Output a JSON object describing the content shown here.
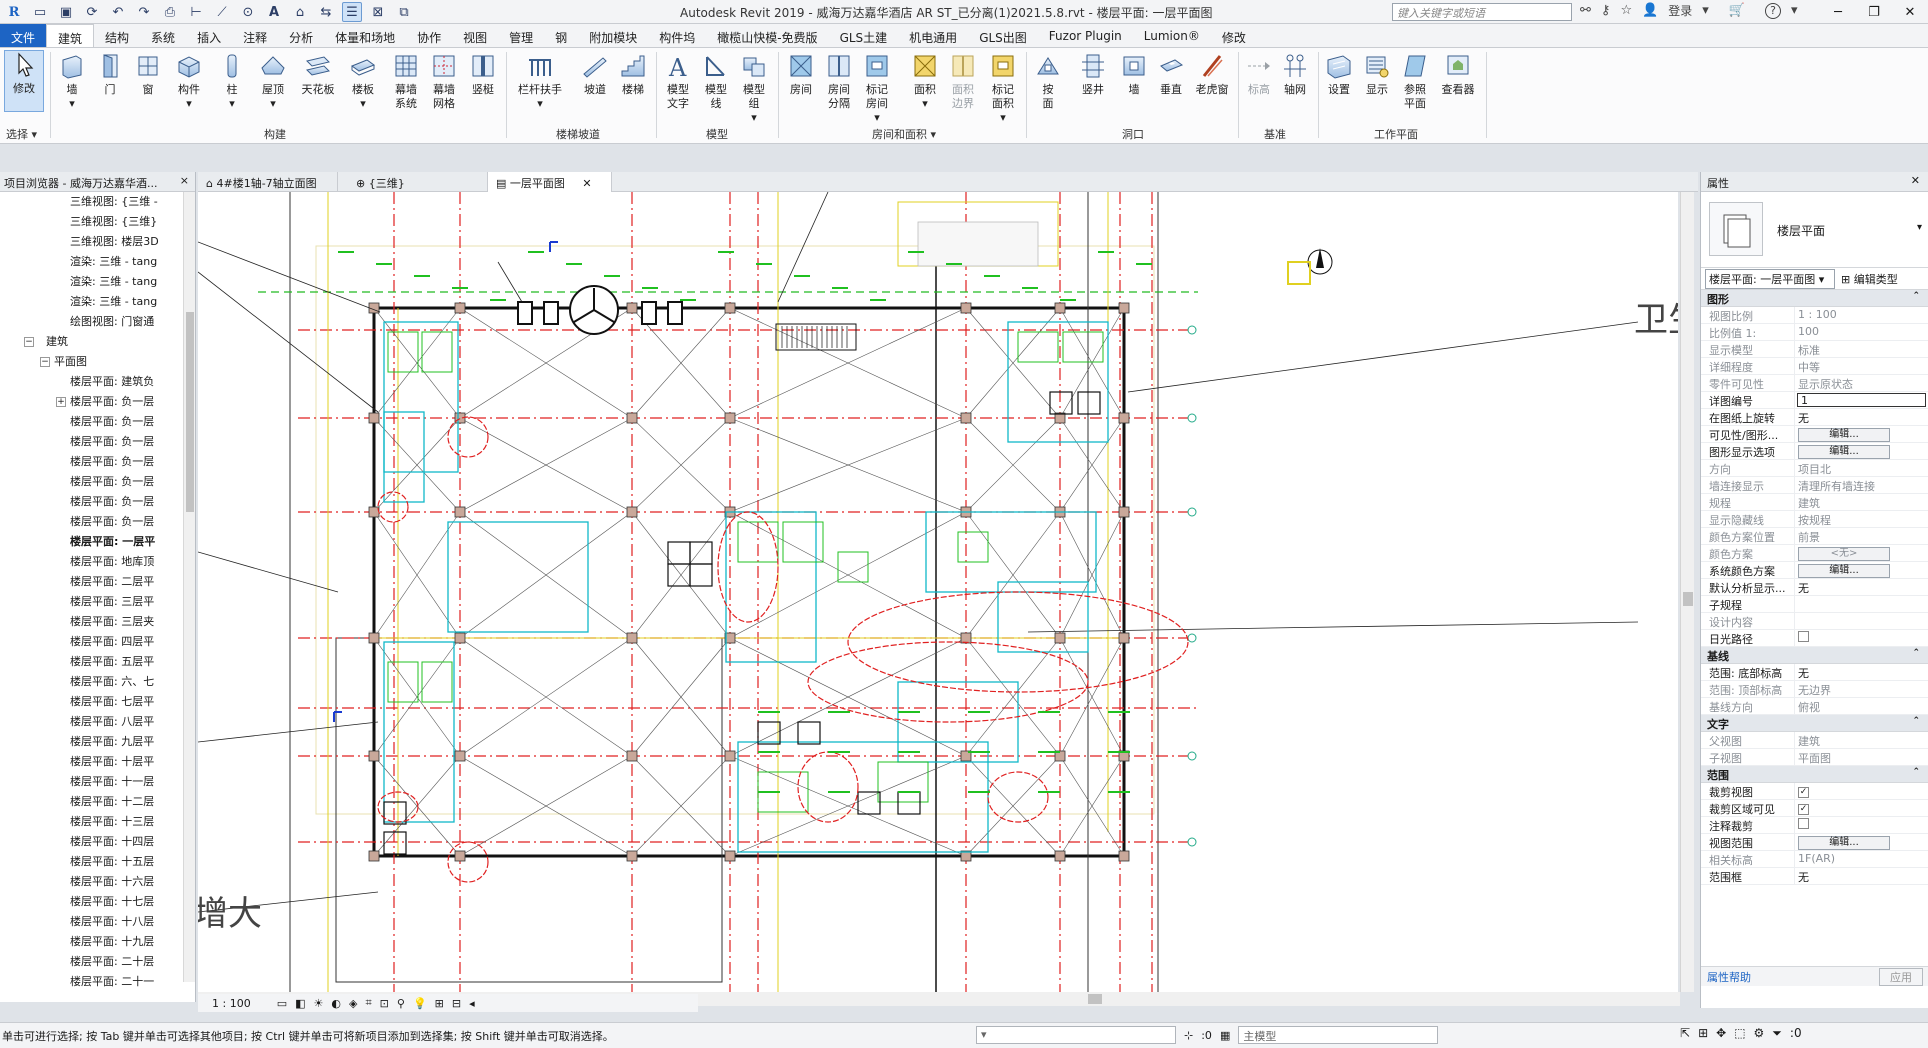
{
  "titlebar": {
    "title": "Autodesk Revit 2019 - 威海万达嘉华酒店 AR ST_已分离(1)2021.5.8.rvt - 楼层平面: 一层平面图",
    "search_placeholder": "键入关键字或短语",
    "login": "登录",
    "help": "?"
  },
  "menu": {
    "tabs": [
      "文件",
      "建筑",
      "结构",
      "系统",
      "插入",
      "注释",
      "分析",
      "体量和场地",
      "协作",
      "视图",
      "管理",
      "钢",
      "附加模块",
      "构件坞",
      "橄榄山快模-免费版",
      "GLS土建",
      "机电通用",
      "GLS出图",
      "Fuzor Plugin",
      "Lumion®",
      "修改"
    ]
  },
  "ribbon": {
    "modify": "修改",
    "select": "选择",
    "buttons": {
      "wall": "墙",
      "door": "门",
      "window": "窗",
      "component": "构件",
      "column": "柱",
      "roof": "屋顶",
      "ceiling": "天花板",
      "floor": "楼板",
      "curtain_system_1": "幕墙",
      "curtain_system_2": "系统",
      "curtain_grid_1": "幕墙",
      "curtain_grid_2": "网格",
      "mullion": "竖梃",
      "railing": "栏杆扶手",
      "ramp": "坡道",
      "stair": "楼梯",
      "model_text_1": "模型",
      "model_text_2": "文字",
      "model_line_1": "模型",
      "model_line_2": "线",
      "model_group_1": "模型",
      "model_group_2": "组",
      "room": "房间",
      "room_sep_1": "房间",
      "room_sep_2": "分隔",
      "tag_room_1": "标记",
      "tag_room_2": "房间",
      "area": "面积",
      "area_boundary_1": "面积",
      "area_boundary_2": "边界",
      "tag_area_1": "标记",
      "tag_area_2": "面积",
      "by_face_1": "按",
      "by_face_2": "面",
      "shaft": "竖井",
      "wall_opening": "墙",
      "vertical": "垂直",
      "dormer": "老虎窗",
      "level": "标高",
      "grid": "轴网",
      "set": "设置",
      "show": "显示",
      "ref_plane_1": "参照",
      "ref_plane_2": "平面",
      "viewer": "查看器"
    },
    "groups": {
      "build": "构建",
      "circulation": "楼梯坡道",
      "model": "模型",
      "room_area": "房间和面积",
      "opening": "洞口",
      "datum": "基准",
      "work_plane": "工作平面"
    }
  },
  "browser": {
    "header": "项目浏览器 - 威海万达嘉华酒...",
    "close": "×",
    "items": [
      {
        "label": "三维视图: {三维 -",
        "indent": 70
      },
      {
        "label": "三维视图: {三维}",
        "indent": 70
      },
      {
        "label": "三维视图: 楼层3D",
        "indent": 70
      },
      {
        "label": "渲染: 三维 - tang",
        "indent": 70
      },
      {
        "label": "渲染: 三维 - tang",
        "indent": 70
      },
      {
        "label": "渲染: 三维 - tang",
        "indent": 70
      },
      {
        "label": "绘图视图: 门窗通",
        "indent": 70
      },
      {
        "label": "建筑",
        "indent": 46,
        "exp": "−",
        "expIndent": 24
      },
      {
        "label": "平面图",
        "indent": 54,
        "exp": "−",
        "expIndent": 40
      },
      {
        "label": "楼层平面: 建筑负",
        "indent": 70
      },
      {
        "label": "楼层平面: 负一层",
        "indent": 70,
        "exp": "+",
        "expIndent": 56
      },
      {
        "label": "楼层平面: 负一层",
        "indent": 70
      },
      {
        "label": "楼层平面: 负一层",
        "indent": 70
      },
      {
        "label": "楼层平面: 负一层",
        "indent": 70
      },
      {
        "label": "楼层平面: 负一层",
        "indent": 70
      },
      {
        "label": "楼层平面: 负一层",
        "indent": 70
      },
      {
        "label": "楼层平面: 负一层",
        "indent": 70
      },
      {
        "label": "楼层平面: 一层平",
        "indent": 70,
        "sel": true
      },
      {
        "label": "楼层平面: 地库顶",
        "indent": 70
      },
      {
        "label": "楼层平面: 二层平",
        "indent": 70
      },
      {
        "label": "楼层平面: 三层平",
        "indent": 70
      },
      {
        "label": "楼层平面: 三层夹",
        "indent": 70
      },
      {
        "label": "楼层平面: 四层平",
        "indent": 70
      },
      {
        "label": "楼层平面: 五层平",
        "indent": 70
      },
      {
        "label": "楼层平面: 六、七",
        "indent": 70
      },
      {
        "label": "楼层平面: 七层平",
        "indent": 70
      },
      {
        "label": "楼层平面: 八层平",
        "indent": 70
      },
      {
        "label": "楼层平面: 九层平",
        "indent": 70
      },
      {
        "label": "楼层平面: 十层平",
        "indent": 70
      },
      {
        "label": "楼层平面: 十一层",
        "indent": 70
      },
      {
        "label": "楼层平面: 十二层",
        "indent": 70
      },
      {
        "label": "楼层平面: 十三层",
        "indent": 70
      },
      {
        "label": "楼层平面: 十四层",
        "indent": 70
      },
      {
        "label": "楼层平面: 十五层",
        "indent": 70
      },
      {
        "label": "楼层平面: 十六层",
        "indent": 70
      },
      {
        "label": "楼层平面: 十七层",
        "indent": 70
      },
      {
        "label": "楼层平面: 十八层",
        "indent": 70
      },
      {
        "label": "楼层平面: 十九层",
        "indent": 70
      },
      {
        "label": "楼层平面: 二十层",
        "indent": 70
      },
      {
        "label": "楼层平面: 二十一",
        "indent": 70
      }
    ]
  },
  "viewtabs": [
    {
      "label": "4#楼1轴-7轴立面图",
      "icon": "elevation"
    },
    {
      "label": "{三维}",
      "icon": "3d"
    },
    {
      "label": "一层平面图",
      "icon": "plan",
      "active": true
    }
  ],
  "canvas": {
    "text_weisheng": "卫生",
    "text_zengda": "增大"
  },
  "viewbar": {
    "scale": "1 : 100"
  },
  "properties": {
    "header": "属性",
    "type_name": "楼层平面",
    "selector": "楼层平面: 一层平面图",
    "edit_type": "编辑类型",
    "groups": [
      {
        "name": "图形",
        "rows": [
          {
            "k": "视图比例",
            "v": "1 : 100",
            "ro": true
          },
          {
            "k": "比例值 1:",
            "v": "100",
            "ro": true
          },
          {
            "k": "显示模型",
            "v": "标准",
            "ro": true
          },
          {
            "k": "详细程度",
            "v": "中等",
            "ro": true
          },
          {
            "k": "零件可见性",
            "v": "显示原状态",
            "ro": true
          },
          {
            "k": "详图编号",
            "v": "1",
            "input": true
          },
          {
            "k": "在图纸上旋转",
            "v": "无"
          },
          {
            "k": "可见性/图形...",
            "btn": "编辑..."
          },
          {
            "k": "图形显示选项",
            "btn": "编辑..."
          },
          {
            "k": "方向",
            "v": "项目北",
            "ro": true
          },
          {
            "k": "墙连接显示",
            "v": "清理所有墙连接",
            "ro": true
          },
          {
            "k": "规程",
            "v": "建筑",
            "ro": true
          },
          {
            "k": "显示隐藏线",
            "v": "按规程",
            "ro": true
          },
          {
            "k": "颜色方案位置",
            "v": "前景",
            "ro": true
          },
          {
            "k": "颜色方案",
            "btn": "<无>",
            "ro": true
          },
          {
            "k": "系统颜色方案",
            "btn": "编辑..."
          },
          {
            "k": "默认分析显示...",
            "v": "无"
          },
          {
            "k": "子规程",
            "v": ""
          },
          {
            "k": "设计内容",
            "v": "",
            "ro": true
          },
          {
            "k": "日光路径",
            "chk": false
          }
        ]
      },
      {
        "name": "基线",
        "rows": [
          {
            "k": "范围: 底部标高",
            "v": "无"
          },
          {
            "k": "范围: 顶部标高",
            "v": "无边界",
            "ro": true
          },
          {
            "k": "基线方向",
            "v": "俯视",
            "ro": true
          }
        ]
      },
      {
        "name": "文字",
        "rows": [
          {
            "k": "父视图",
            "v": "建筑",
            "ro": true
          },
          {
            "k": "子视图",
            "v": "平面图",
            "ro": true
          }
        ]
      },
      {
        "name": "范围",
        "rows": [
          {
            "k": "裁剪视图",
            "chk": true
          },
          {
            "k": "裁剪区域可见",
            "chk": true
          },
          {
            "k": "注释裁剪",
            "chk": false
          },
          {
            "k": "视图范围",
            "btn": "编辑..."
          },
          {
            "k": "相关标高",
            "v": "1F(AR)",
            "ro": true
          },
          {
            "k": "范围框",
            "v": "无"
          }
        ]
      }
    ],
    "help": "属性帮助",
    "apply": "应用"
  },
  "status": {
    "text": "单击可进行选择; 按 Tab 键并单击可选择其他项目; 按 Ctrl 键并单击可将新项目添加到选择集; 按 Shift 键并单击可取消选择。",
    "count": ":0",
    "model": "主模型",
    "filter_count": ":0"
  }
}
